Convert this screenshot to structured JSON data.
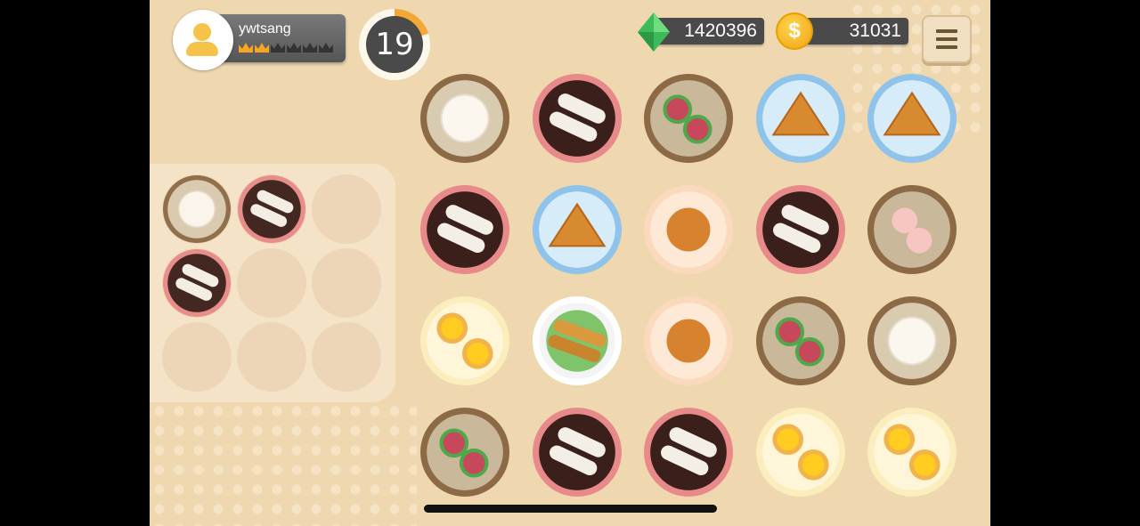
{
  "player": {
    "username": "ywtsang",
    "crowns_filled": 2,
    "crowns_total": 6
  },
  "timer": {
    "seconds": "19",
    "progress_fraction": 0.2
  },
  "currency": {
    "gems": "1420396",
    "coins": "31031"
  },
  "colors": {
    "crown_gold": "#f5a623",
    "crown_dark": "#333333",
    "timer_ring": "#f4a735"
  },
  "tray": {
    "slots": [
      "bao-basket",
      "cheung-fun-plate",
      "",
      "cheung-fun-plate",
      "",
      "",
      "",
      "",
      ""
    ]
  },
  "board": {
    "rows": [
      [
        "bao-basket",
        "cheung-fun-plate",
        "pepper-basket",
        "toast-plate",
        "toast-plate"
      ],
      [
        "cheung-fun-plate",
        "toast-plate",
        "sesame-ball-plate",
        "cheung-fun-plate",
        "har-gow-basket"
      ],
      [
        "egg-tart-plate",
        "spring-roll-plate",
        "sesame-ball-plate",
        "pepper-basket",
        "bao-basket"
      ],
      [
        "pepper-basket",
        "cheung-fun-plate",
        "cheung-fun-plate",
        "egg-tart-plate",
        "egg-tart-plate"
      ]
    ]
  },
  "icons": {
    "menu": "hamburger-menu-icon",
    "gem": "green-gem-icon",
    "coin": "gold-coin-icon",
    "avatar": "user-avatar-icon"
  }
}
